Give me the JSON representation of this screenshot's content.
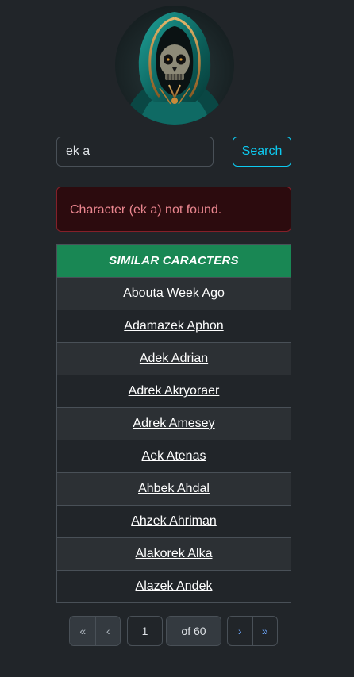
{
  "search": {
    "value": "ek a",
    "button_label": "Search"
  },
  "alert": {
    "message": "Character (ek a) not found."
  },
  "table": {
    "header": "SIMILAR CARACTERS",
    "rows": [
      "Abouta Week Ago",
      "Adamazek Aphon",
      "Adek Adrian",
      "Adrek Akryoraer",
      "Adrek Amesey",
      "Aek Atenas",
      "Ahbek Ahdal",
      "Ahzek Ahriman",
      "Alakorek Alka",
      "Alazek Andek"
    ]
  },
  "pagination": {
    "first": "«",
    "prev": "‹",
    "page": "1",
    "of": "of 60",
    "next": "›",
    "last": "»"
  },
  "colors": {
    "header_bg": "#198754",
    "alert_bg": "#2c0b0e",
    "alert_text": "#ea868f",
    "accent": "#0dcaf0"
  }
}
